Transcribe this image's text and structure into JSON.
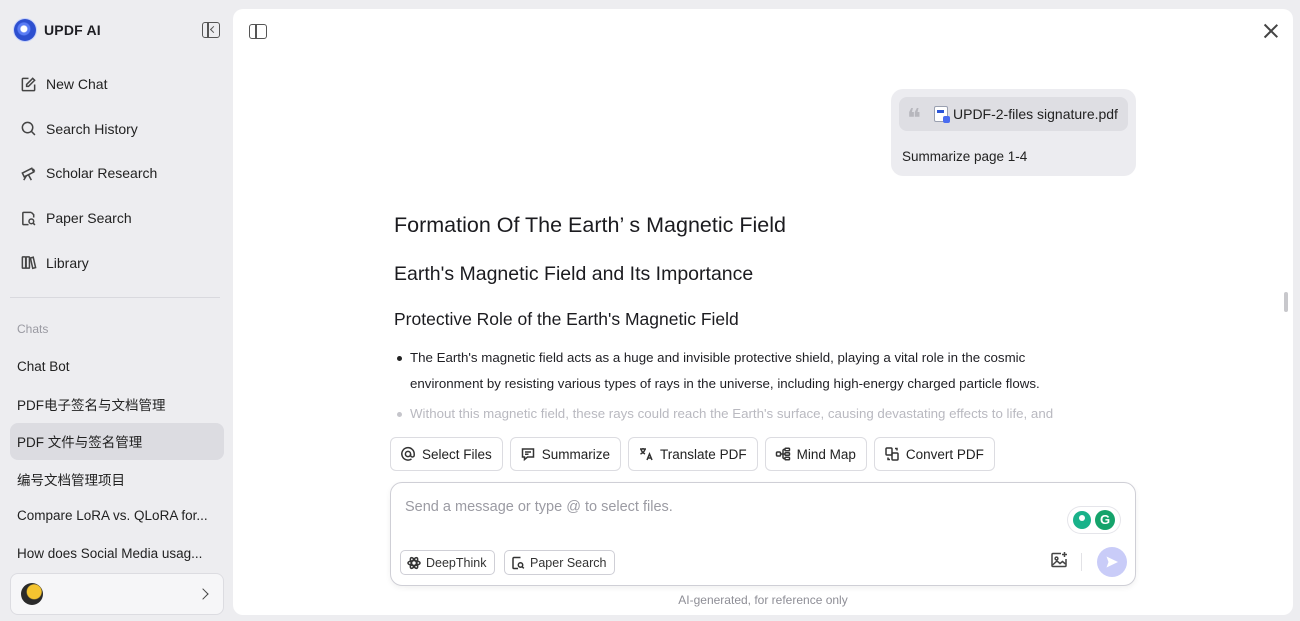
{
  "app": {
    "name": "UPDF AI"
  },
  "sidebar": {
    "nav": [
      {
        "label": "New Chat",
        "icon": "edit-icon"
      },
      {
        "label": "Search History",
        "icon": "search-icon"
      },
      {
        "label": "Scholar Research",
        "icon": "telescope-icon"
      },
      {
        "label": "Paper Search",
        "icon": "paper-search-icon"
      },
      {
        "label": "Library",
        "icon": "library-icon"
      }
    ],
    "chats_label": "Chats",
    "chats": [
      {
        "label": "Chat Bot"
      },
      {
        "label": "PDF电子签名与文档管理"
      },
      {
        "label": "PDF 文件与签名管理",
        "active": true
      },
      {
        "label": "编号文档管理项目"
      },
      {
        "label": "Compare LoRA vs. QLoRA for..."
      },
      {
        "label": "How does Social Media usag..."
      }
    ]
  },
  "conversation": {
    "user_message": {
      "file_name": "UPDF-2-files signature.pdf",
      "text": "Summarize page 1-4"
    },
    "answer": {
      "h1": "Formation Of The Earth’ s Magnetic Field",
      "h2": "Earth's Magnetic Field and Its Importance",
      "h3": "Protective Role of the Earth's Magnetic Field",
      "bullets": [
        "The Earth's magnetic field acts as a huge and invisible protective shield, playing a vital role in the cosmic environment by resisting various types of rays in the universe, including high-energy charged particle flows.",
        "Without this magnetic field, these rays could reach the Earth's surface, causing devastating effects to life, and"
      ]
    }
  },
  "tools": [
    {
      "label": "Select Files",
      "icon": "at-icon"
    },
    {
      "label": "Summarize",
      "icon": "summarize-icon"
    },
    {
      "label": "Translate PDF",
      "icon": "translate-icon"
    },
    {
      "label": "Mind Map",
      "icon": "mind-map-icon"
    },
    {
      "label": "Convert PDF",
      "icon": "convert-icon"
    }
  ],
  "composer": {
    "placeholder": "Send a message or type @ to select files.",
    "value": "",
    "deepthink_label": "DeepThink",
    "paper_search_label": "Paper Search"
  },
  "footnote": "AI-generated, for reference only",
  "colors": {
    "accent": "#5a6cf0",
    "send_disabled": "#c9ccf8",
    "active_chat": "#dcdce1",
    "grammarly": "#15a36b"
  }
}
